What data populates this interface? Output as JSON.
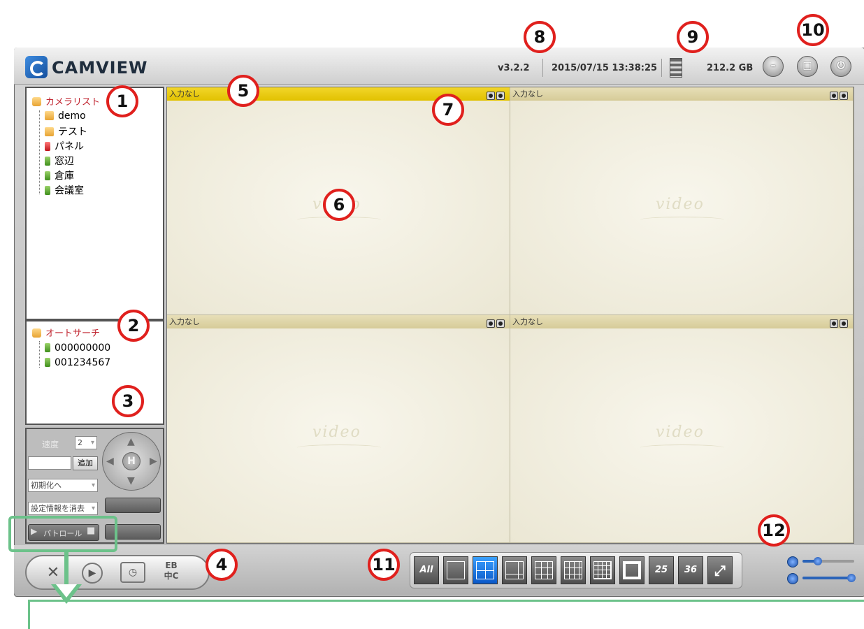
{
  "app": {
    "logo_text": "CAMVIEW",
    "version": "v3.2.2",
    "datetime": "2015/07/15 13:38:25",
    "storage": "212.2 GB"
  },
  "camera_list": {
    "root": "カメラリスト",
    "items": [
      {
        "label": "demo",
        "status": "folder"
      },
      {
        "label": "テスト",
        "status": "folder"
      },
      {
        "label": "パネル",
        "status": "red"
      },
      {
        "label": "窓辺",
        "status": "green"
      },
      {
        "label": "倉庫",
        "status": "green"
      },
      {
        "label": "会議室",
        "status": "green"
      }
    ]
  },
  "auto_search": {
    "root": "オートサーチ",
    "items": [
      {
        "label": "000000000",
        "status": "green"
      },
      {
        "label": "001234567",
        "status": "green"
      }
    ]
  },
  "ptz": {
    "speed_label": "速度",
    "speed_value": "2",
    "add_button": "追加",
    "preset_select": "初期化へ",
    "clear_select": "設定情報を消去",
    "patrol_button": "パトロール",
    "home_label": "H"
  },
  "video_cells": [
    {
      "title": "入力なし",
      "watermark": "video",
      "active": true
    },
    {
      "title": "入力なし",
      "watermark": "video",
      "active": false
    },
    {
      "title": "入力なし",
      "watermark": "video",
      "active": false
    },
    {
      "title": "入力なし",
      "watermark": "video",
      "active": false
    }
  ],
  "bottom_tools": {
    "lang_label_top": "EB",
    "lang_label_bottom": "中C"
  },
  "layout_buttons": {
    "all": "All",
    "n25": "25",
    "n36": "36",
    "selected": "4-split"
  },
  "volume": {
    "mic_level": 0.3,
    "speaker_level": 0.95
  },
  "annotations": [
    "1",
    "2",
    "3",
    "4",
    "5",
    "6",
    "7",
    "8",
    "9",
    "10",
    "11",
    "12"
  ],
  "colors": {
    "annotation_red": "#e0201d",
    "highlight_green": "#6cc28a",
    "active_cell_bar": "#e1c100",
    "selected_layout": "#0a58c8"
  }
}
